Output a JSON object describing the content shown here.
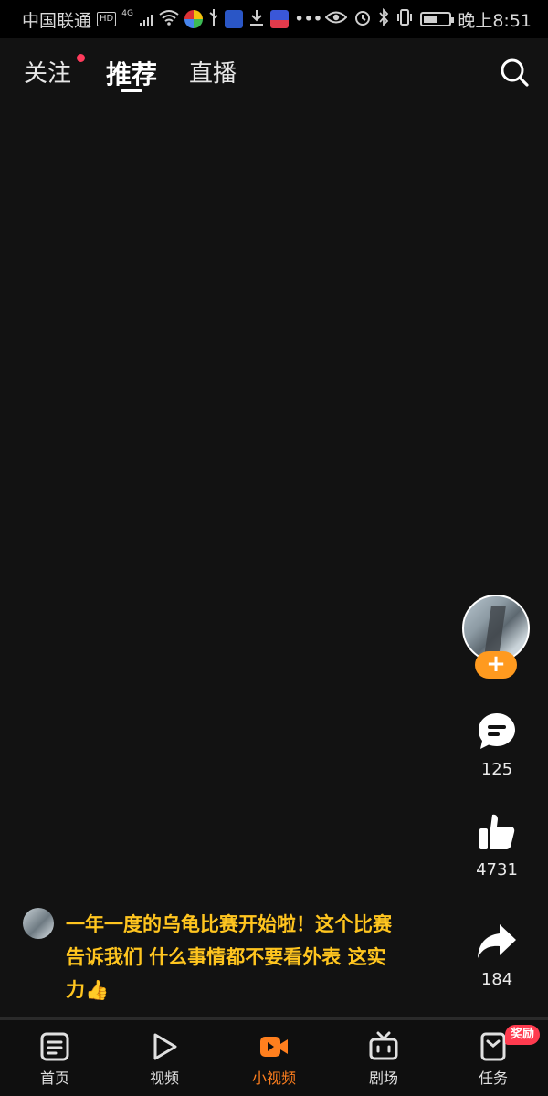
{
  "status_bar": {
    "carrier": "中国联通",
    "hd": "HD",
    "network": "4G",
    "time": "晚上8:51",
    "battery_level": 0.55
  },
  "top_nav": {
    "tabs": [
      {
        "label": "关注",
        "has_dot": true
      },
      {
        "label": "推荐",
        "active": true
      },
      {
        "label": "直播"
      }
    ]
  },
  "actions": {
    "follow_symbol": "+",
    "comments": "125",
    "likes": "4731",
    "shares": "184"
  },
  "caption": {
    "text": "一年一度的乌龟比赛开始啦！这个比赛告诉我们 什么事情都不要看外表 这实力👍"
  },
  "bottom_nav": {
    "items": [
      {
        "label": "首页",
        "icon": "home-icon"
      },
      {
        "label": "视频",
        "icon": "play-icon"
      },
      {
        "label": "小视频",
        "icon": "short-video-icon",
        "active": true
      },
      {
        "label": "剧场",
        "icon": "tv-icon"
      },
      {
        "label": "任务",
        "icon": "task-icon"
      }
    ],
    "badge": "奖励"
  },
  "colors": {
    "background": "#121212",
    "accent_orange": "#ff9a1f",
    "caption_yellow": "#ffc51f",
    "badge_red": "#ff3b4f"
  }
}
